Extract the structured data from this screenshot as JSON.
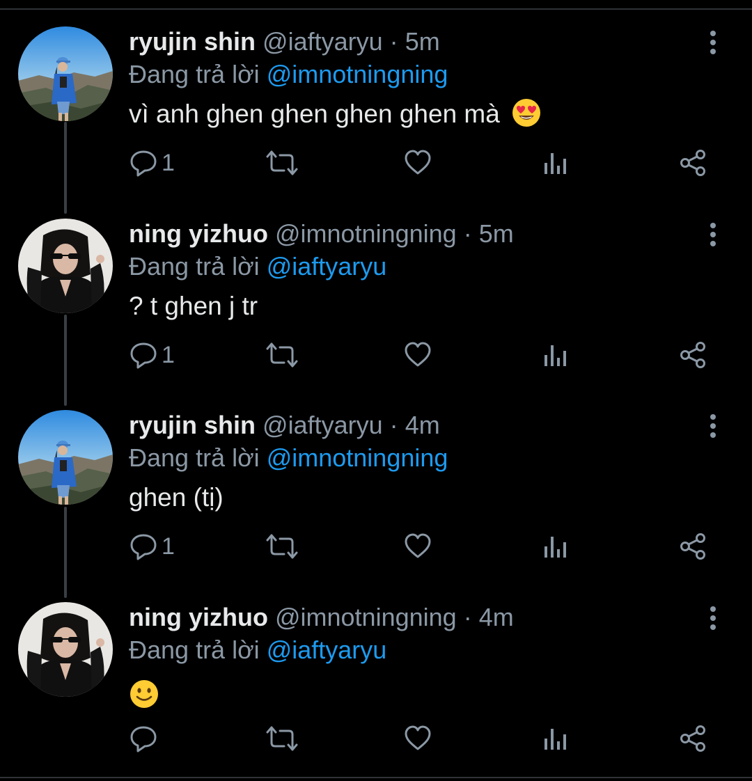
{
  "theme": {
    "background": "#000000",
    "text": "#e7e9ea",
    "muted": "#8b98a5",
    "link": "#1d9bf0",
    "thread_line": "#3a3f44"
  },
  "replying_prefix": "Đang trả lời",
  "tweets": [
    {
      "name": "ryujin shin",
      "handle": "@iaftyaryu",
      "separator": "·",
      "time": "5m",
      "replying_to": "@imnotningning",
      "text": "vì anh ghen ghen ghen ghen mà",
      "emoji": "smiling-face-with-heart-eyes",
      "reply_count": "1",
      "avatar": "ryujin-avatar"
    },
    {
      "name": "ning yizhuo",
      "handle": "@imnotningning",
      "separator": "·",
      "time": "5m",
      "replying_to": "@iaftyaryu",
      "text": "? t ghen j tr",
      "reply_count": "1",
      "avatar": "ning-avatar"
    },
    {
      "name": "ryujin shin",
      "handle": "@iaftyaryu",
      "separator": "·",
      "time": "4m",
      "replying_to": "@imnotningning",
      "text": "ghen (tị)",
      "reply_count": "1",
      "avatar": "ryujin-avatar"
    },
    {
      "name": "ning yizhuo",
      "handle": "@imnotningning",
      "separator": "·",
      "time": "4m",
      "replying_to": "@iaftyaryu",
      "text": "",
      "emoji": "slightly-smiling-face",
      "reply_count": "",
      "avatar": "ning-avatar"
    }
  ],
  "icons": {
    "reply": "reply-icon",
    "retweet": "retweet-icon",
    "like": "heart-icon",
    "views": "analytics-icon",
    "share": "share-icon",
    "more": "more-vertical-icon"
  }
}
